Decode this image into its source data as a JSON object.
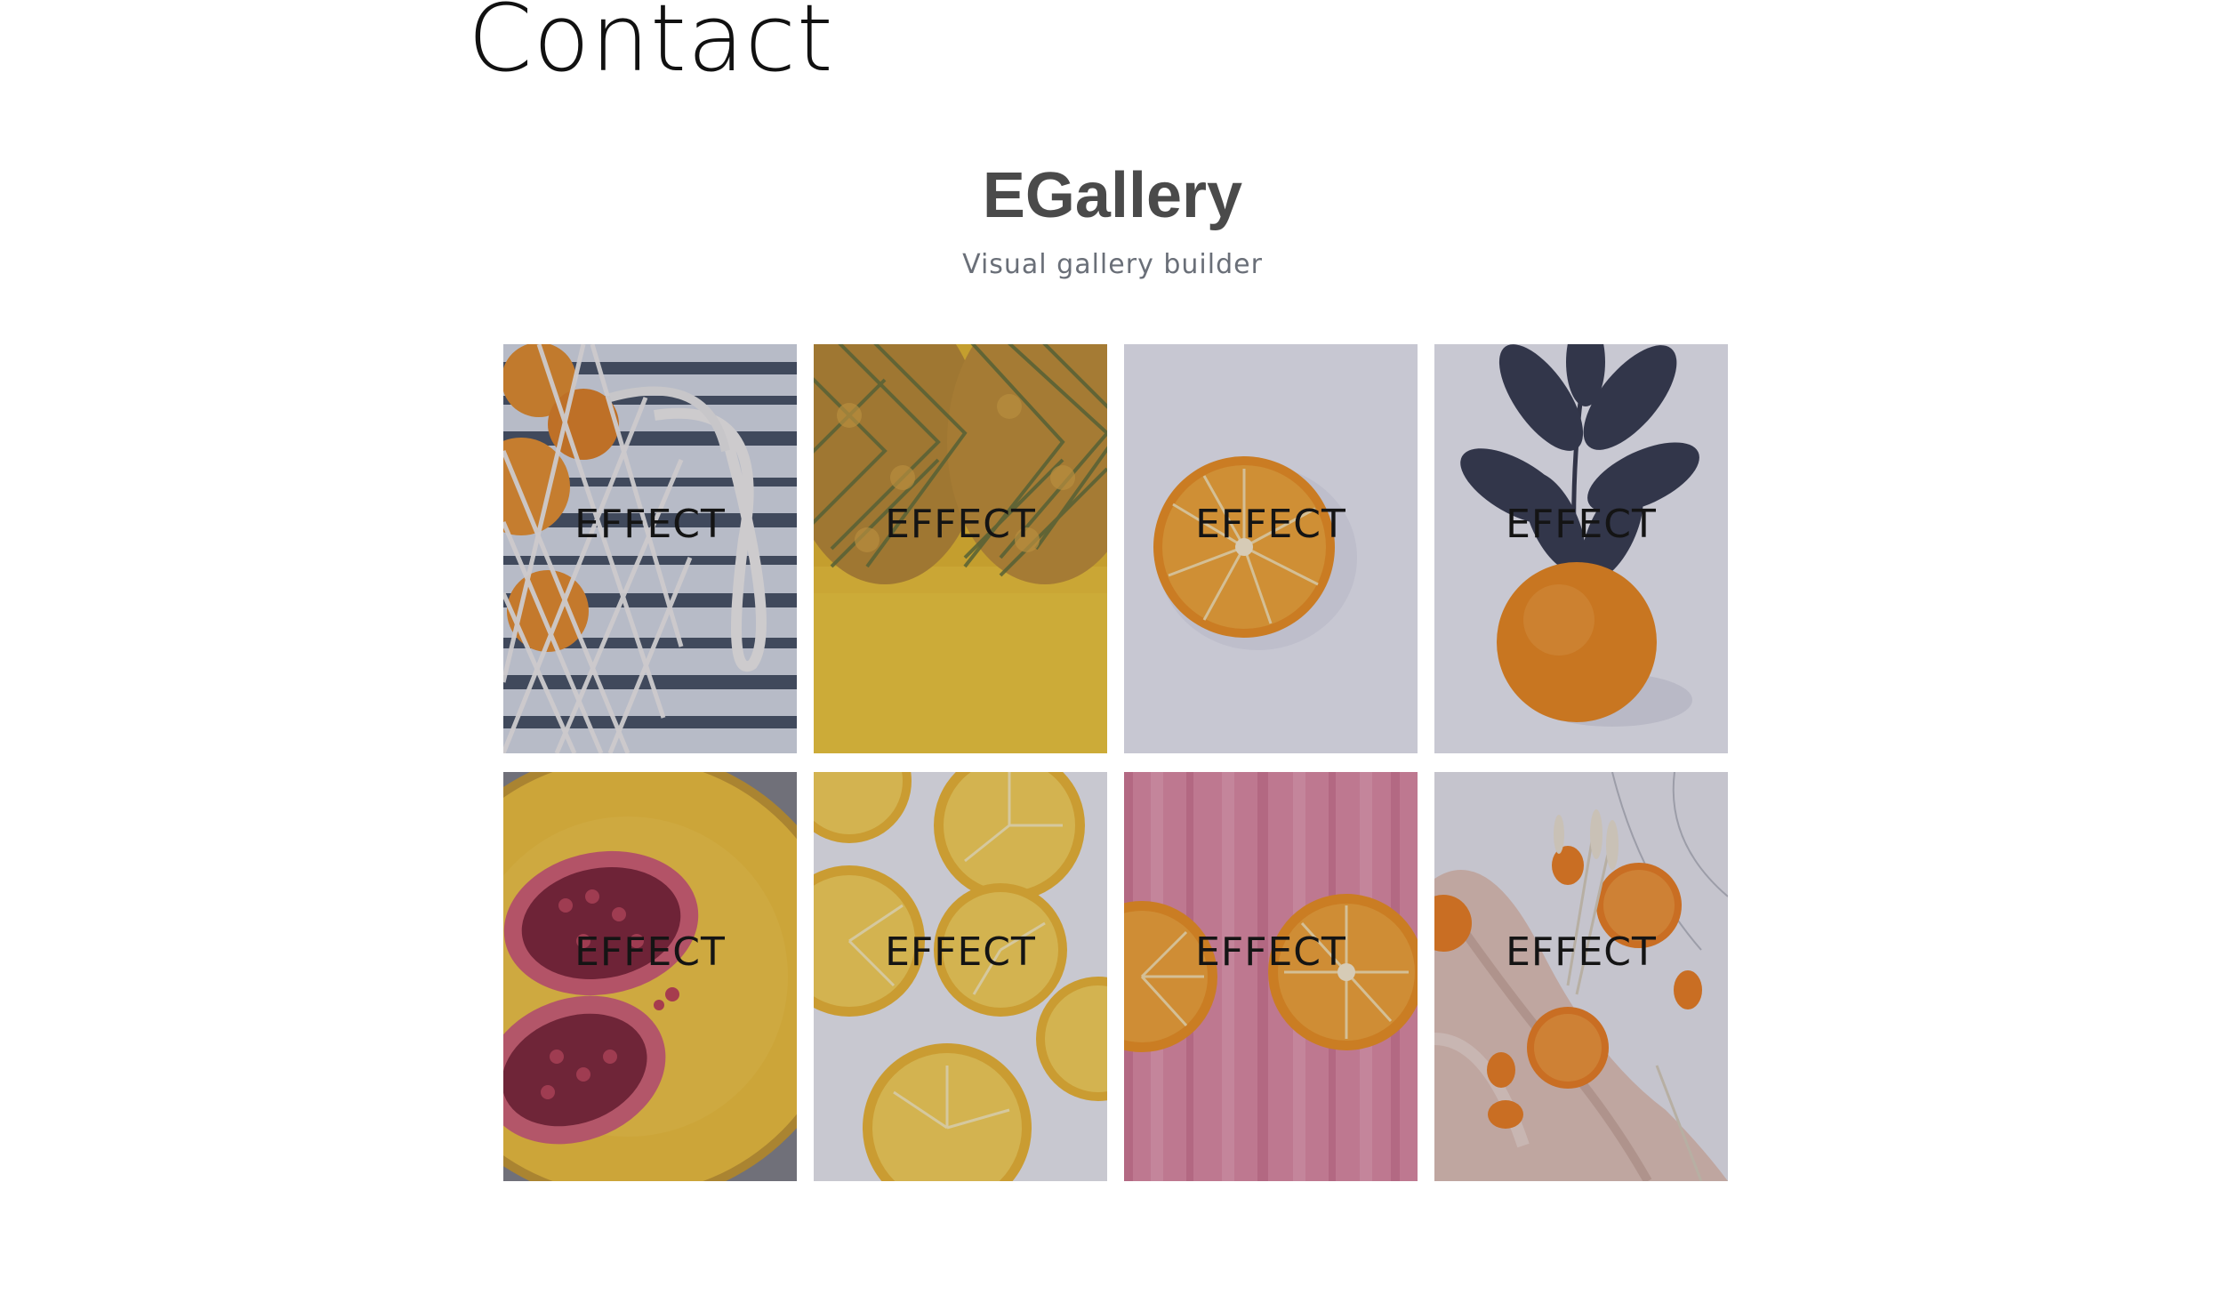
{
  "page": {
    "title": "Contact"
  },
  "gallery": {
    "title": "EGallery",
    "subtitle": "Visual gallery builder",
    "tiles": [
      {
        "label": "EFFECT",
        "image": "oranges-in-mesh-bag"
      },
      {
        "label": "EFFECT",
        "image": "pineapples"
      },
      {
        "label": "EFFECT",
        "image": "orange-half"
      },
      {
        "label": "EFFECT",
        "image": "orange-with-leaves"
      },
      {
        "label": "EFFECT",
        "image": "pomegranate-on-plate"
      },
      {
        "label": "EFFECT",
        "image": "lemon-slices"
      },
      {
        "label": "EFFECT",
        "image": "oranges-on-pink-wood"
      },
      {
        "label": "EFFECT",
        "image": "tangerines-on-silk"
      }
    ]
  },
  "colors": {
    "page_background": "#ffffff",
    "title_text": "#111111",
    "gallery_title": "#4a4a4a",
    "subtitle_text": "#6a6f78",
    "overlay_text": "#141414"
  }
}
